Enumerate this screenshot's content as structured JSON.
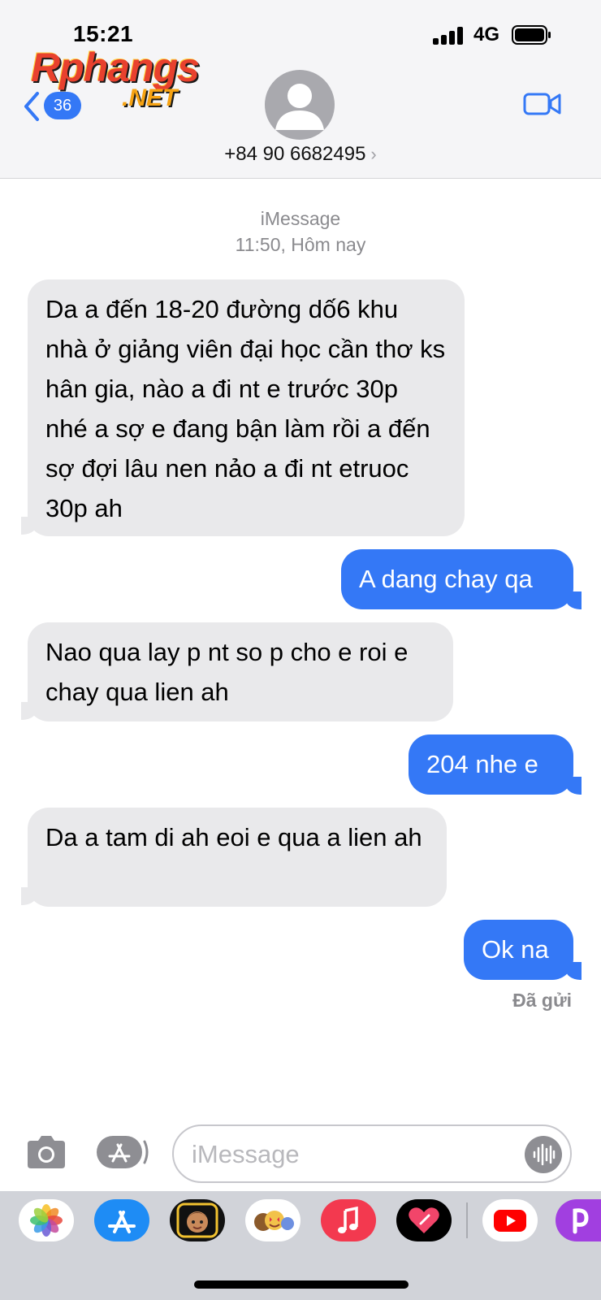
{
  "status_bar": {
    "time": "15:21",
    "network": "4G"
  },
  "watermark": {
    "main": "Rphangs",
    "sub": ".NET"
  },
  "header": {
    "back_badge": "36",
    "contact": "+84 90 6682495",
    "contact_chevron": "›",
    "icons": [
      "chevron-left-icon",
      "avatar-icon",
      "video-camera-icon"
    ]
  },
  "conversation": {
    "service": "iMessage",
    "timestamp": "11:50, Hôm nay",
    "messages": [
      {
        "direction": "incoming",
        "text": "Da a đến 18-20 đường dố6 khu nhà ở giảng viên  đại học cần thơ ks hân gia, nào a đi nt e trước 30p nhé a sợ e đang bận làm rồi a đến sợ đợi lâu nen nảo a đi nt etruoc 30p ah"
      },
      {
        "direction": "outgoing",
        "text": "A dang chay qa"
      },
      {
        "direction": "incoming",
        "text": "Nao qua lay p nt so p cho e roi e chay qua lien ah"
      },
      {
        "direction": "outgoing",
        "text": "204 nhe e"
      },
      {
        "direction": "incoming",
        "text": "Da a tam di ah eoi e qua a lien ah"
      },
      {
        "direction": "outgoing",
        "text": "Ok na"
      }
    ],
    "delivered": "Đã gửi"
  },
  "composer": {
    "placeholder": "iMessage",
    "icons": [
      "camera-icon",
      "app-store-icon",
      "audio-waveform-icon"
    ]
  },
  "app_drawer": {
    "apps": [
      "photos-app-icon",
      "app-store-app-icon",
      "memoji-app-icon",
      "animoji-app-icon",
      "music-app-icon",
      "digital-touch-app-icon",
      "youtube-app-icon",
      "picsart-app-icon"
    ],
    "colors": {
      "accent": "#3478f6",
      "incoming_bubble": "#e9e9eb"
    }
  }
}
